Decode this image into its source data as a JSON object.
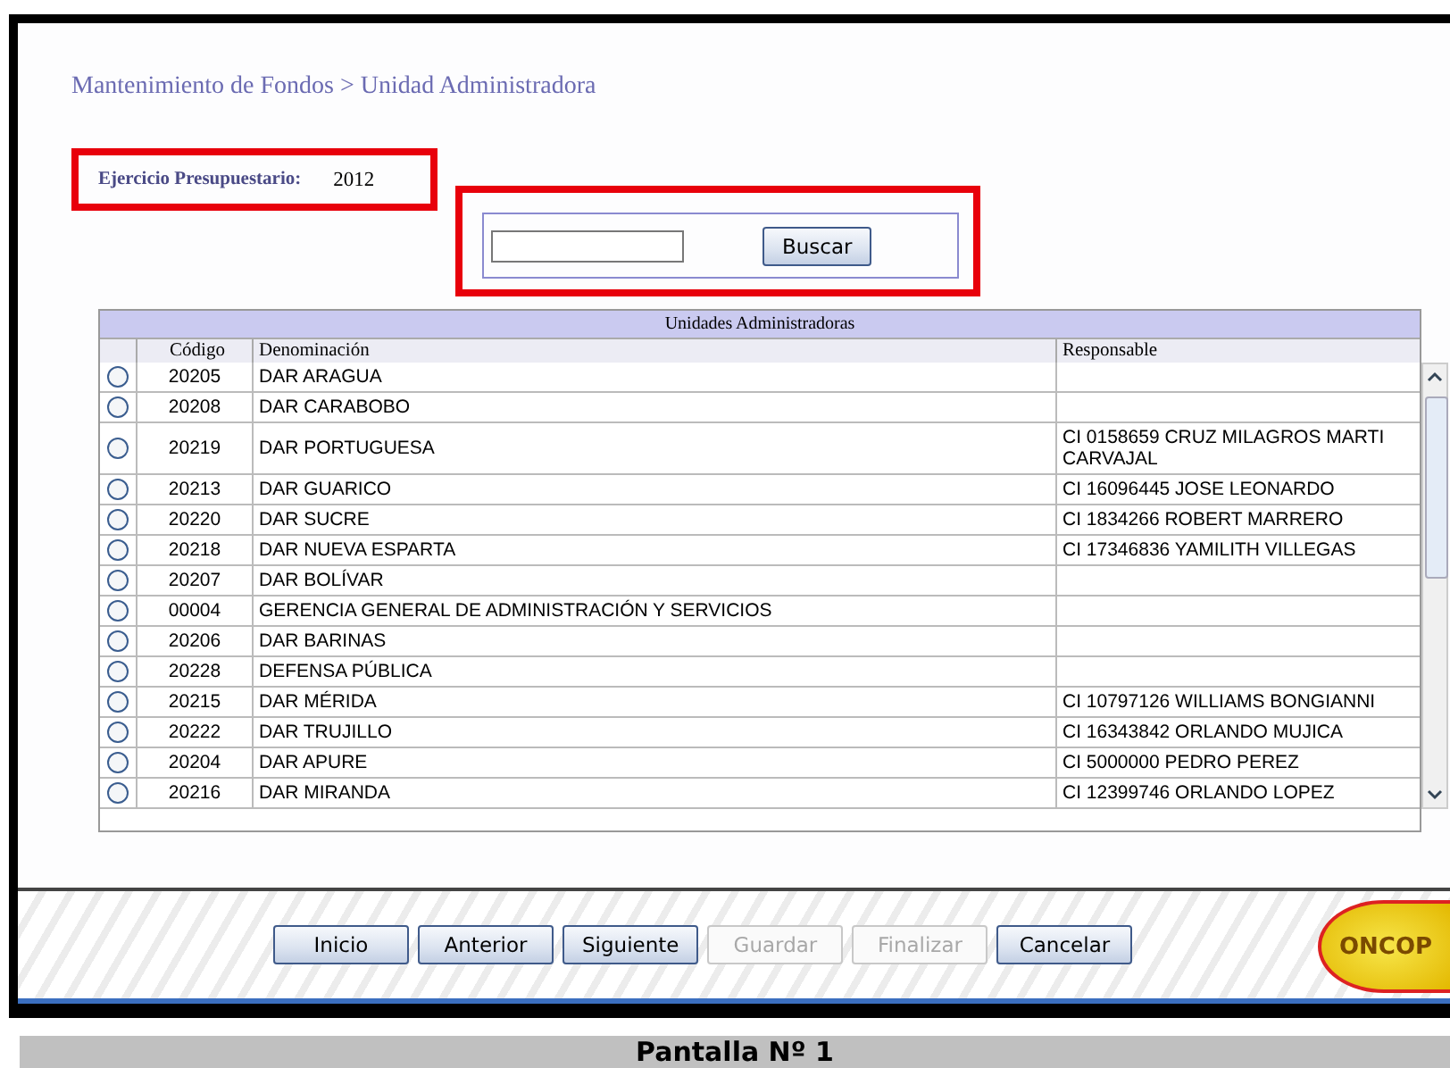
{
  "breadcrumb": "Mantenimiento de Fondos > Unidad Administradora",
  "fiscal_year": {
    "label": "Ejercicio Presupuestario:",
    "value": "2012"
  },
  "search": {
    "button": "Buscar"
  },
  "table": {
    "title": "Unidades Administradoras",
    "columns": [
      "Código",
      "Denominación",
      "Responsable"
    ],
    "rows": [
      {
        "selected": false,
        "code": "20205",
        "name": "DAR ARAGUA",
        "responsible": ""
      },
      {
        "selected": false,
        "code": "20208",
        "name": "DAR CARABOBO",
        "responsible": ""
      },
      {
        "selected": false,
        "code": "20219",
        "name": "DAR PORTUGUESA",
        "responsible": "CI 0158659  CRUZ MILAGROS MARTI CARVAJAL"
      },
      {
        "selected": false,
        "code": "20213",
        "name": "DAR GUARICO",
        "responsible": "CI 16096445  JOSE LEONARDO"
      },
      {
        "selected": false,
        "code": "20220",
        "name": "DAR SUCRE",
        "responsible": "CI 1834266  ROBERT MARRERO"
      },
      {
        "selected": false,
        "code": "20218",
        "name": "DAR NUEVA ESPARTA",
        "responsible": "CI 17346836  YAMILITH VILLEGAS"
      },
      {
        "selected": false,
        "code": "20207",
        "name": "DAR BOLÍVAR",
        "responsible": ""
      },
      {
        "selected": false,
        "code": "00004",
        "name": "GERENCIA GENERAL DE ADMINISTRACIÓN Y SERVICIOS",
        "responsible": ""
      },
      {
        "selected": false,
        "code": "20206",
        "name": "DAR BARINAS",
        "responsible": ""
      },
      {
        "selected": false,
        "code": "20228",
        "name": "DEFENSA PÚBLICA",
        "responsible": ""
      },
      {
        "selected": false,
        "code": "20215",
        "name": "DAR MÉRIDA",
        "responsible": "CI 10797126  WILLIAMS BONGIANNI"
      },
      {
        "selected": false,
        "code": "20222",
        "name": "DAR TRUJILLO",
        "responsible": "CI 16343842  ORLANDO MUJICA"
      },
      {
        "selected": false,
        "code": "20204",
        "name": "DAR APURE",
        "responsible": "CI 5000000  PEDRO PEREZ"
      },
      {
        "selected": false,
        "code": "20216",
        "name": "DAR MIRANDA",
        "responsible": "CI 12399746  ORLANDO LOPEZ"
      }
    ]
  },
  "buttons": [
    {
      "label": "Inicio",
      "disabled": false
    },
    {
      "label": "Anterior",
      "disabled": false
    },
    {
      "label": "Siguiente",
      "disabled": false
    },
    {
      "label": "Guardar",
      "disabled": true
    },
    {
      "label": "Finalizar",
      "disabled": true
    },
    {
      "label": "Cancelar",
      "disabled": false
    }
  ],
  "logo": "ONCOP",
  "caption": "Pantalla Nº 1"
}
